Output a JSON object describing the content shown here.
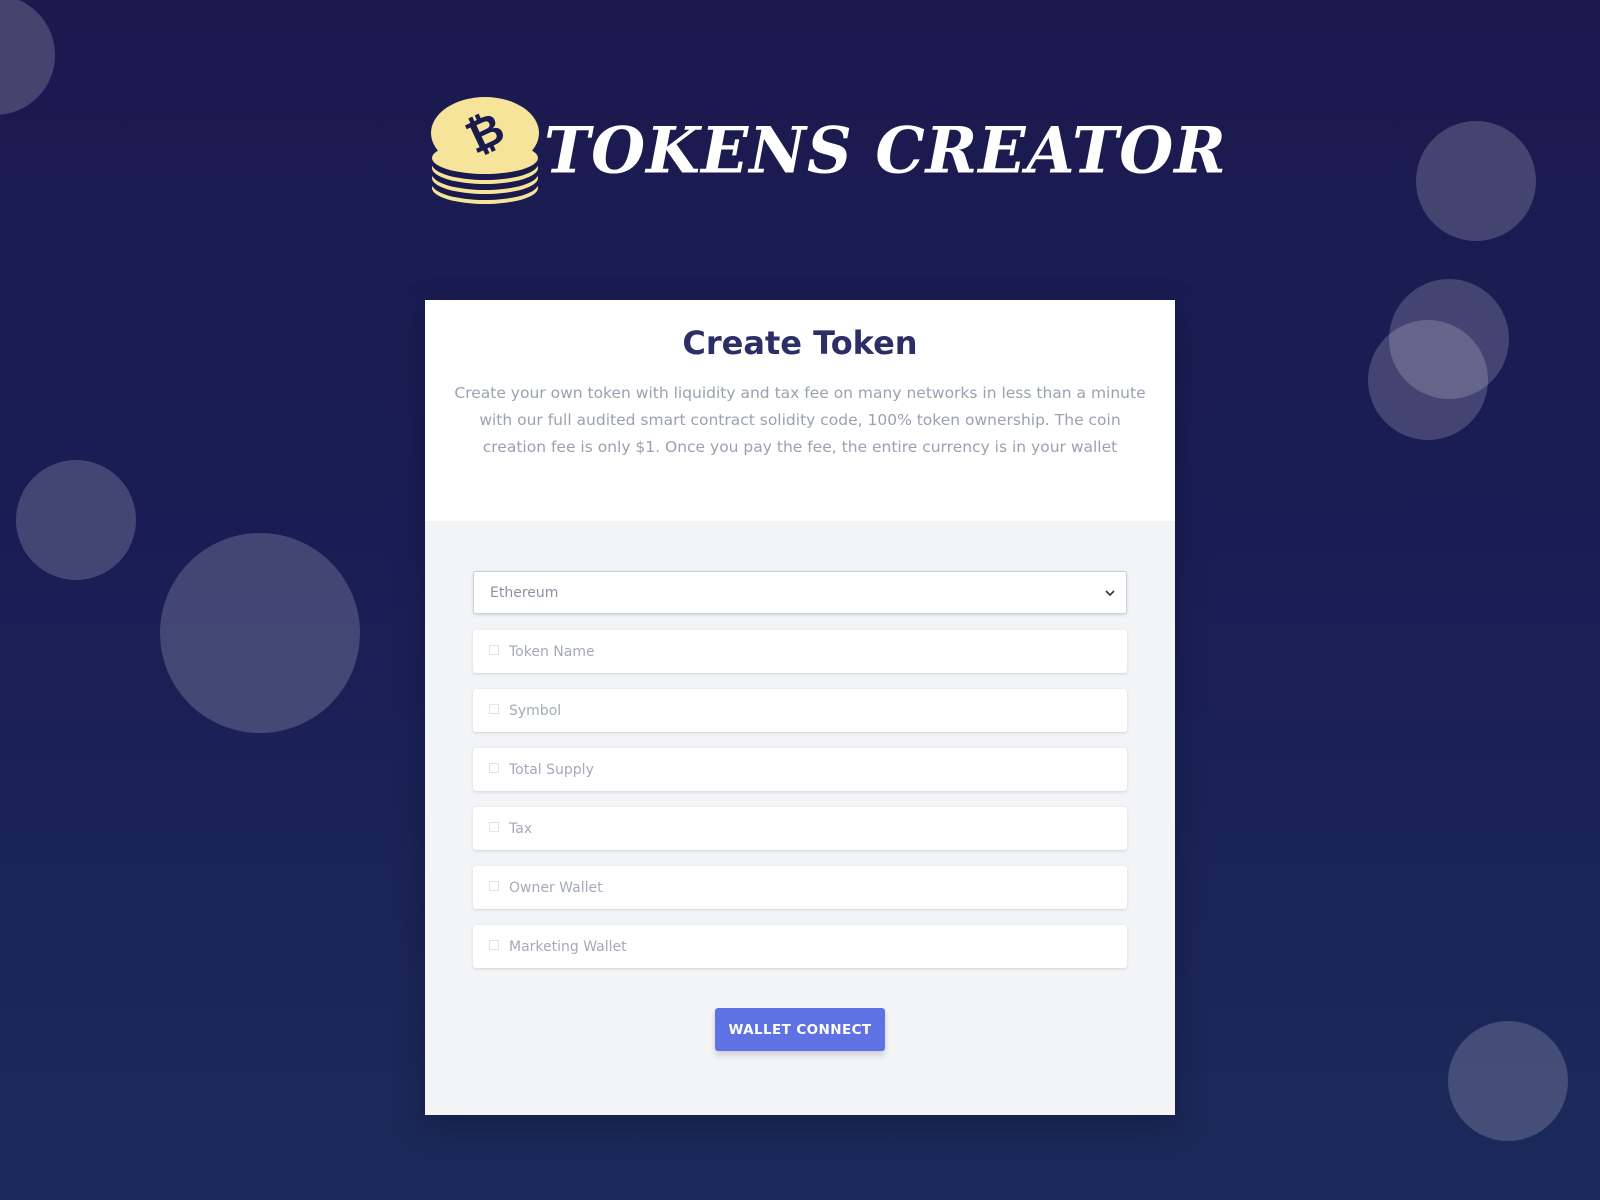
{
  "brand": {
    "name": "TOKENS CREATOR",
    "coin_color": "#f5e49a",
    "symbol_color": "#1b1a4f"
  },
  "card": {
    "title": "Create Token",
    "description": "Create your own token with liquidity and tax fee on many networks in less than a minute with our full audited smart contract solidity code, 100% token ownership. The coin creation fee is only $1. Once you pay the fee, the entire currency is in your wallet"
  },
  "form": {
    "network_select": {
      "value": "Ethereum"
    },
    "fields": [
      {
        "placeholder": "Token Name"
      },
      {
        "placeholder": "Symbol"
      },
      {
        "placeholder": "Total Supply"
      },
      {
        "placeholder": "Tax"
      },
      {
        "placeholder": "Owner Wallet"
      },
      {
        "placeholder": "Marketing Wallet"
      }
    ],
    "submit_label": "WALLET CONNECT"
  },
  "colors": {
    "accent": "#5e72e4",
    "background": "#1b1a4f"
  }
}
